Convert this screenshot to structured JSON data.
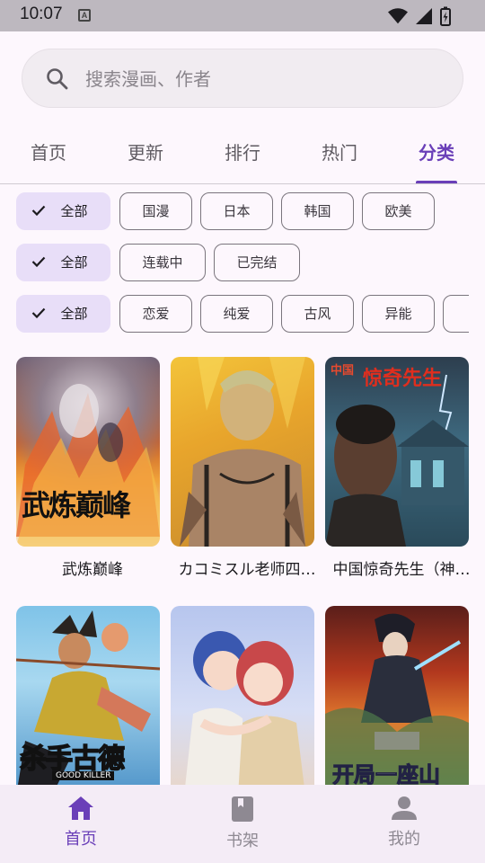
{
  "status_bar": {
    "time": "10:07",
    "notification_glyph": "A"
  },
  "search": {
    "placeholder": "搜索漫画、作者"
  },
  "tabs": [
    {
      "label": "首页"
    },
    {
      "label": "更新"
    },
    {
      "label": "排行"
    },
    {
      "label": "热门"
    },
    {
      "label": "分类",
      "active": true
    }
  ],
  "filters": {
    "region": [
      "全部",
      "国漫",
      "日本",
      "韩国",
      "欧美"
    ],
    "status": [
      "全部",
      "连载中",
      "已完结"
    ],
    "genre": [
      "全部",
      "恋爱",
      "纯爱",
      "古风",
      "异能"
    ],
    "selected": "全部"
  },
  "comics": [
    {
      "title": "武炼巅峰",
      "cover_text": "武炼巅峰"
    },
    {
      "title": "カコミスル老师四…",
      "cover_text": ""
    },
    {
      "title": "中国惊奇先生（神…",
      "cover_text": "惊奇先生",
      "cover_badge": "中国"
    },
    {
      "title": "",
      "cover_text": "杀手古德",
      "cover_sub": "GOOD KILLER"
    },
    {
      "title": "",
      "cover_text": ""
    },
    {
      "title": "",
      "cover_text": "开局一座山"
    }
  ],
  "bottom_nav": [
    {
      "label": "首页",
      "icon": "home-icon",
      "active": true
    },
    {
      "label": "书架",
      "icon": "book-icon"
    },
    {
      "label": "我的",
      "icon": "person-icon"
    }
  ],
  "colors": {
    "accent": "#6A3FB8",
    "chip_selected": "#E8DEF8",
    "background": "#FDF7FD"
  }
}
